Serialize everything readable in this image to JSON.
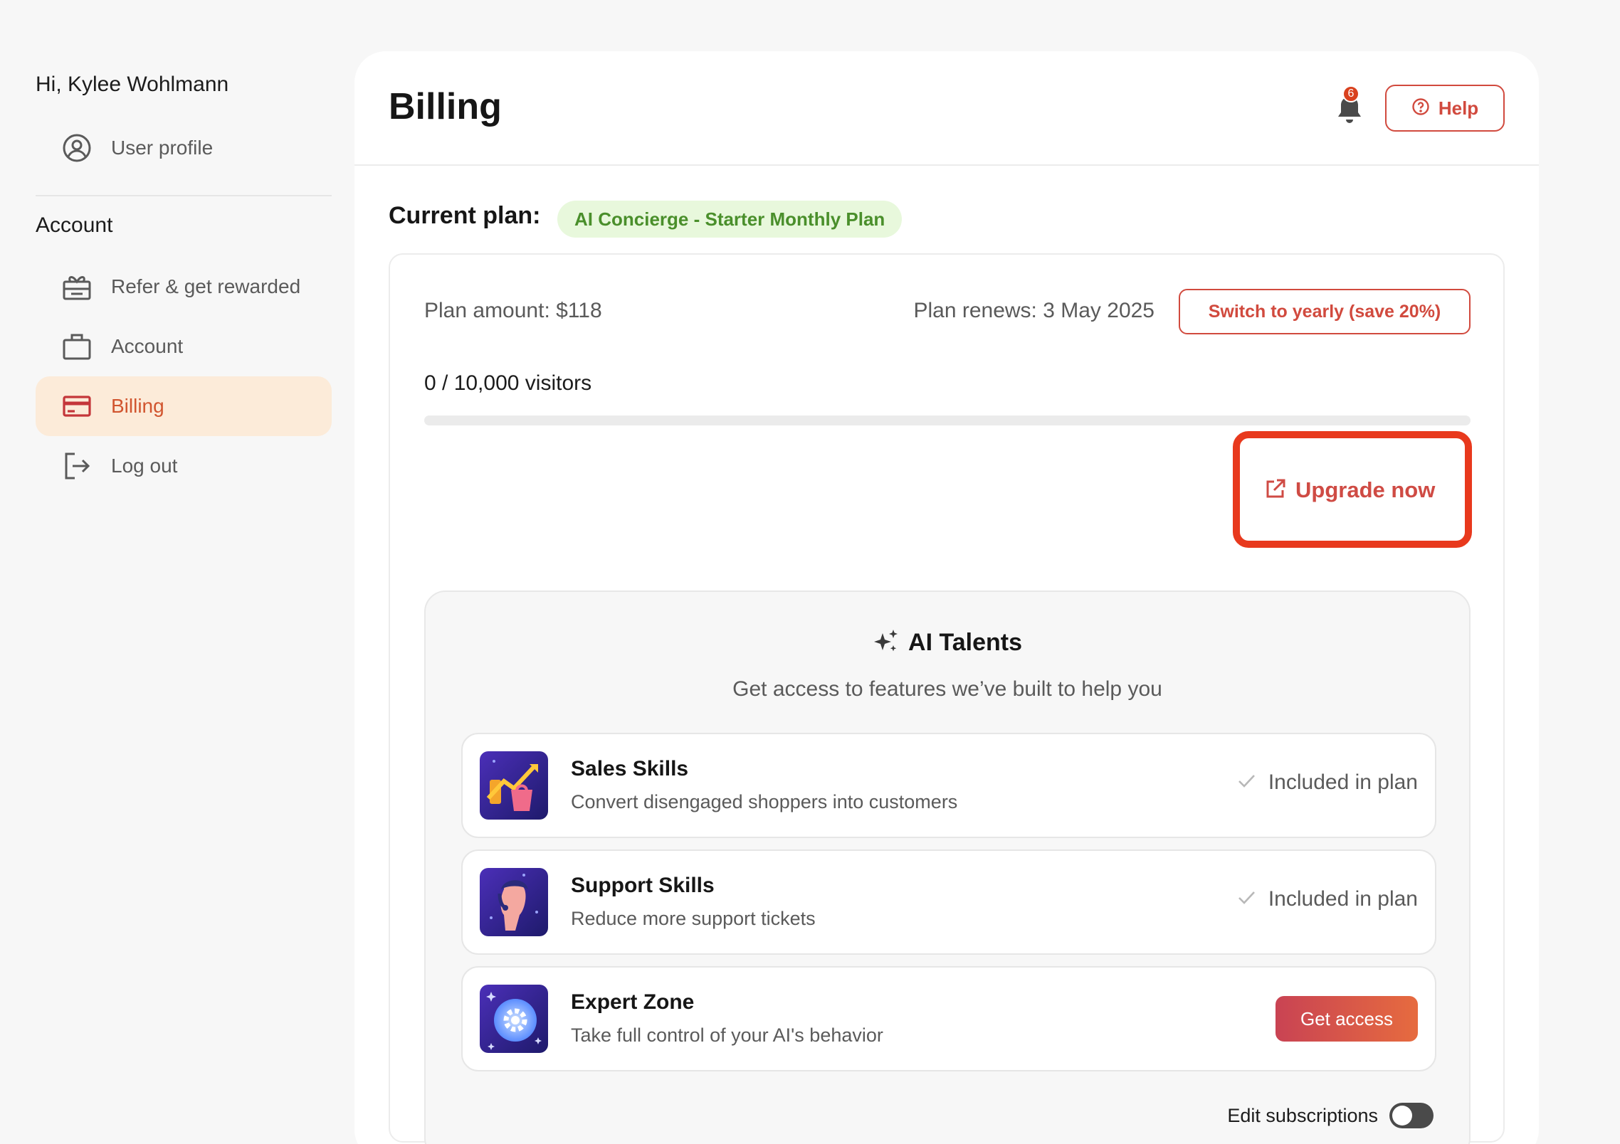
{
  "sidebar": {
    "greeting": "Hi, Kylee Wohlmann",
    "profile_label": "User profile",
    "section_title": "Account",
    "items": [
      {
        "label": "Refer & get rewarded",
        "icon": "gift-icon"
      },
      {
        "label": "Account",
        "icon": "briefcase-icon"
      },
      {
        "label": "Billing",
        "icon": "credit-card-icon",
        "active": true
      },
      {
        "label": "Log out",
        "icon": "logout-icon"
      }
    ]
  },
  "header": {
    "title": "Billing",
    "notification_count": "6",
    "help_label": "Help"
  },
  "plan": {
    "current_plan_label": "Current plan:",
    "plan_name": "AI Concierge - Starter Monthly Plan",
    "amount": "Plan amount: $118",
    "renews": "Plan renews: 3 May 2025",
    "switch_label": "Switch to yearly (save 20%)",
    "visitors": "0 / 10,000 visitors",
    "visitors_used": 0,
    "visitors_limit": 10000,
    "upgrade_label": "Upgrade now"
  },
  "talents": {
    "title": "AI Talents",
    "subtitle": "Get access to features we’ve built to help you",
    "skills": [
      {
        "name": "Sales Skills",
        "description": "Convert disengaged shoppers into customers",
        "status": "Included in plan"
      },
      {
        "name": "Support Skills",
        "description": "Reduce more support tickets",
        "status": "Included in plan"
      },
      {
        "name": "Expert Zone",
        "description": "Take full control of your AI's behavior",
        "action": "Get access"
      }
    ],
    "edit_subscriptions_label": "Edit subscriptions",
    "edit_subscriptions_on": false
  },
  "colors": {
    "accent": "#d14a3e",
    "highlight": "#e8391d",
    "active_nav_bg": "#fcebd9",
    "plan_pill_bg": "#e8f8dc",
    "plan_pill_text": "#4a8f2b"
  }
}
